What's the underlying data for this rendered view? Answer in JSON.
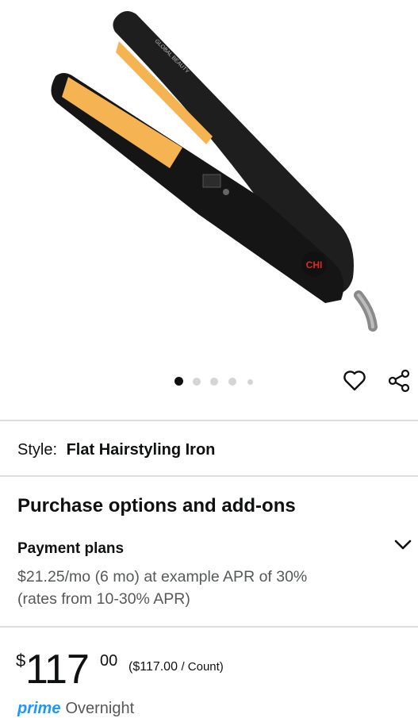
{
  "product": {
    "image_label": "CHI",
    "image_brand_text": "GLOBAL BEAUTY"
  },
  "carousel": {
    "count": 5,
    "active_index": 0
  },
  "style": {
    "label": "Style:",
    "value": "Flat Hairstyling Iron"
  },
  "purchase": {
    "title": "Purchase options and add-ons",
    "payment_title": "Payment plans",
    "payment_text": "$21.25/mo (6 mo) at example APR of 30% (rates from 10-30% APR)"
  },
  "price": {
    "symbol": "$",
    "whole": "117",
    "fraction": "00",
    "unit_value": "($117.00",
    "unit_suffix": "/ Count)"
  },
  "delivery": {
    "prime": "prime",
    "text": "Overnight"
  },
  "colors": {
    "accent": "#1a98ff",
    "text": "#0f1111",
    "muted": "#565959",
    "divider": "#dddddd"
  }
}
